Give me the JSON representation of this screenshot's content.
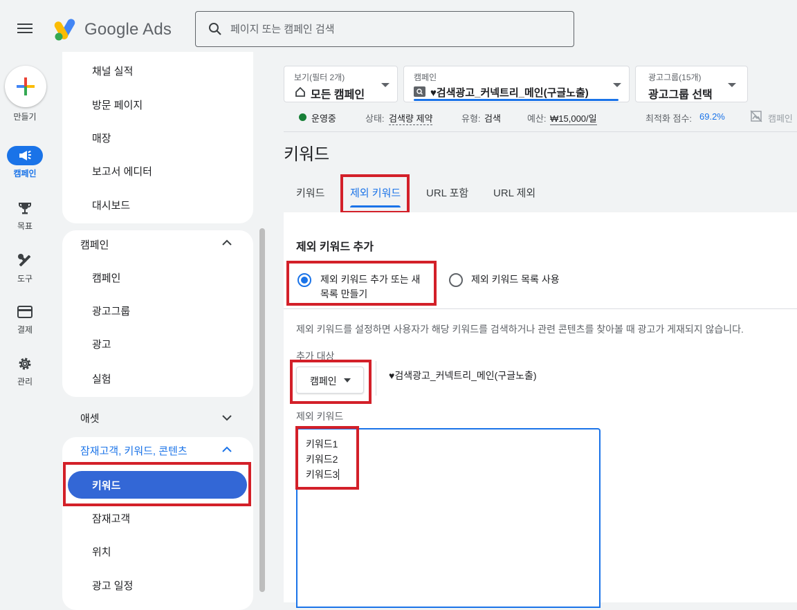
{
  "app": {
    "name": "Google Ads"
  },
  "search": {
    "placeholder": "페이지 또는 캠페인 검색"
  },
  "rail": {
    "create_label": "만들기",
    "items": [
      {
        "label": "캠페인"
      },
      {
        "label": "목표"
      },
      {
        "label": "도구"
      },
      {
        "label": "결제"
      },
      {
        "label": "관리"
      }
    ]
  },
  "sidenav": {
    "group1_items": [
      "채널 실적",
      "방문 페이지",
      "매장",
      "보고서 에디터",
      "대시보드"
    ],
    "campaign_section": {
      "title": "캠페인",
      "items": [
        "캠페인",
        "광고그룹",
        "광고",
        "실험"
      ]
    },
    "assets_section": {
      "title": "애셋"
    },
    "audience_section": {
      "title": "잠재고객, 키워드, 콘텐츠",
      "items": [
        "키워드",
        "잠재고객",
        "위치",
        "광고 일정"
      ]
    }
  },
  "selectors": {
    "view": {
      "label": "보기(필터 2개)",
      "value": "모든 캠페인"
    },
    "campaign": {
      "label": "캠페인",
      "value": "♥검색광고_커넥트리_메인(구글노출)"
    },
    "adgroup": {
      "label": "광고그룹(15개)",
      "value": "광고그룹 선택"
    }
  },
  "status": {
    "state": "운영중",
    "status_label": "상태:",
    "status_value": "검색량 제약",
    "type_label": "유형:",
    "type_value": "검색",
    "budget_label": "예산:",
    "budget_value": "₩15,000/일",
    "score_label": "최적화 점수:",
    "score_value": "69.2%",
    "campaign_link": "캠페인"
  },
  "page": {
    "title": "키워드"
  },
  "tabs": [
    "키워드",
    "제외 키워드",
    "URL 포함",
    "URL 제외"
  ],
  "form": {
    "section_title": "제외 키워드 추가",
    "radio1_line1": "제외 키워드 추가 또는 새",
    "radio1_line2": "목록 만들기",
    "radio2": "제외 키워드 목록 사용",
    "description": "제외 키워드를 설정하면 사용자가 해당 키워드를 검색하거나 관련 콘텐츠를 찾아볼 때 광고가 게재되지 않습니다.",
    "target_label": "추가 대상",
    "target_dropdown": "캠페인",
    "target_value": "♥검색광고_커넥트리_메인(구글노출)",
    "keywords_label": "제외 키워드",
    "keywords": [
      "키워드1",
      "키워드2",
      "키워드3"
    ]
  },
  "colors": {
    "accent": "#1a73e8",
    "active_nav": "#3367d6",
    "highlight": "#d32029",
    "status_green": "#188038"
  }
}
